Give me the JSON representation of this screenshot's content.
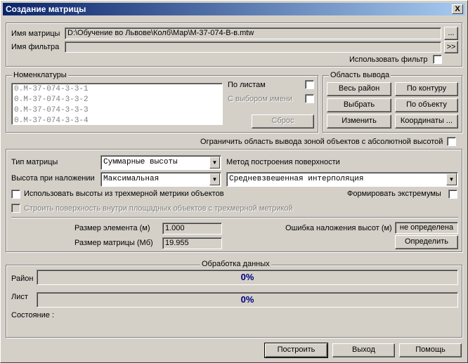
{
  "title": "Создание матрицы",
  "close_label": "X",
  "file": {
    "matrix_label": "Имя матрицы",
    "matrix_value": "D:\\Обучение во Львове\\Колб\\Map\\M-37-074-B-в.mtw",
    "browse": "...",
    "filter_label": "Имя фильтра",
    "filter_value": "",
    "filter_btn": ">>",
    "use_filter": "Использовать фильтр"
  },
  "nom": {
    "caption": "Номенклатуры",
    "items": [
      "0.M-37-074-3-3-1",
      "0.M-37-074-3-3-2",
      "0.M-37-074-3-3-3",
      "0.M-37-074-3-3-4"
    ],
    "by_sheets": "По листам",
    "by_name": "С выбором имени",
    "reset": "Сброс"
  },
  "out": {
    "caption": "Область вывода",
    "all": "Весь район",
    "contour": "По контуру",
    "select": "Выбрать",
    "object": "По объекту",
    "change": "Изменить",
    "coords": "Координаты ..."
  },
  "limit": "Ограничить область вывода зоной объектов с абсолютной высотой",
  "params": {
    "type_label": "Тип матрицы",
    "type_value": "Суммарные высоты",
    "method_label": "Метод построения поверхности",
    "height_label": "Высота при наложении",
    "height_value": "Максимальная",
    "method_value": "Средневзвешенная интерполяция",
    "use_3d": "Использовать высоты из трехмерной метрики объектов",
    "extrema": "Формировать экстремумы",
    "build_surface": "Строить поверхность внутри площадных объектов с трехмерной метрикой",
    "elem_label": "Размер элемента (м)",
    "elem_value": "1.000",
    "matrix_size_label": "Размер матрицы (Мб)",
    "matrix_size_value": "19.955",
    "err_label": "Ошибка наложения высот (м)",
    "err_value": "не определена",
    "define": "Определить"
  },
  "proc": {
    "caption": "Обработка данных",
    "region": "Район",
    "region_pct": "0%",
    "sheet": "Лист",
    "sheet_pct": "0%",
    "state": "Состояние :"
  },
  "buttons": {
    "build": "Построить",
    "exit": "Выход",
    "help": "Помощь"
  }
}
